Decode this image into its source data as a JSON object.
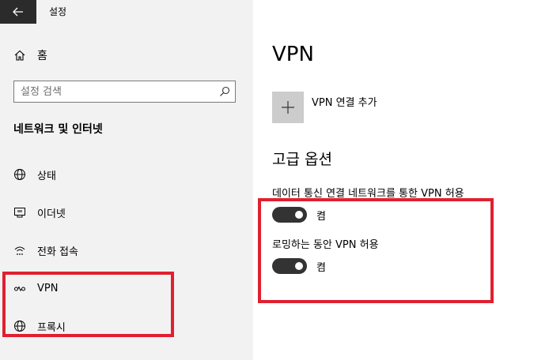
{
  "app": {
    "title": "설정"
  },
  "sidebar": {
    "home_label": "홈",
    "search_placeholder": "설정 검색",
    "section_heading": "네트워크 및 인터넷",
    "items": [
      {
        "label": "상태",
        "icon": "globe-status-icon"
      },
      {
        "label": "이더넷",
        "icon": "ethernet-icon"
      },
      {
        "label": "전화 접속",
        "icon": "dial-up-icon"
      },
      {
        "label": "VPN",
        "icon": "vpn-icon"
      },
      {
        "label": "프록시",
        "icon": "globe-icon"
      }
    ]
  },
  "main": {
    "title": "VPN",
    "add_vpn_label": "VPN 연결 추가",
    "advanced_heading": "고급 옵션",
    "options": [
      {
        "label": "데이터 통신 연결 네트워크를 통한 VPN 허용",
        "state": "켬",
        "on": true
      },
      {
        "label": "로밍하는 동안 VPN 허용",
        "state": "켬",
        "on": true
      }
    ]
  },
  "colors": {
    "highlight": "#e02030",
    "toggle_on": "#333333",
    "sidebar_bg": "#f2f2f2"
  }
}
